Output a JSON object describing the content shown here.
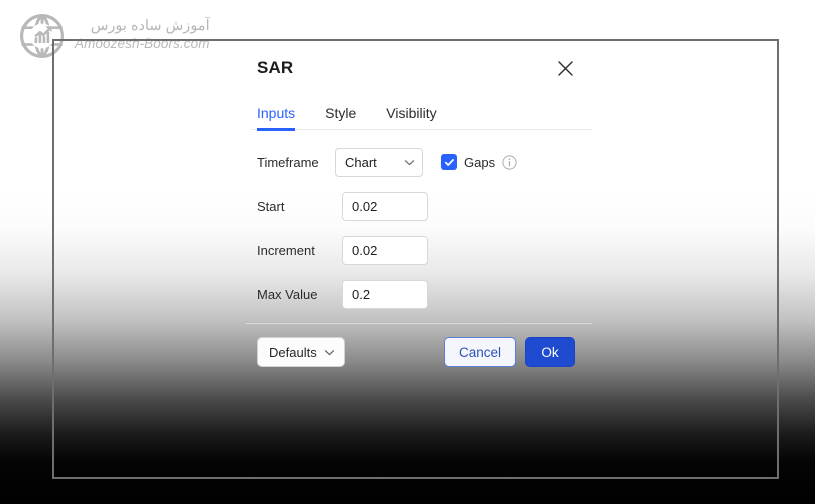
{
  "watermark": {
    "icon": "globe-chart-logo",
    "persian_text": "آموزش ساده بورس",
    "site": "Amoozesh-Boors.com"
  },
  "dialog": {
    "title": "SAR",
    "close_icon": "close-icon",
    "tabs": [
      {
        "label": "Inputs",
        "active": true
      },
      {
        "label": "Style",
        "active": false
      },
      {
        "label": "Visibility",
        "active": false
      }
    ],
    "fields": {
      "timeframe": {
        "label": "Timeframe",
        "value": "Chart",
        "chevron_icon": "chevron-down-icon"
      },
      "gaps": {
        "label": "Gaps",
        "checked": true,
        "check_icon": "check-icon",
        "info_icon": "info-icon"
      },
      "start": {
        "label": "Start",
        "value": "0.02"
      },
      "increment": {
        "label": "Increment",
        "value": "0.02"
      },
      "max_value": {
        "label": "Max Value",
        "value": "0.2"
      }
    },
    "footer": {
      "defaults_label": "Defaults",
      "defaults_chevron_icon": "chevron-down-icon",
      "cancel_label": "Cancel",
      "ok_label": "Ok"
    }
  },
  "colors": {
    "accent": "#2962ff",
    "ok_button": "#1f4bd0",
    "cancel_text": "#2f52b8",
    "frame_border": "#6e6e6e",
    "watermark_text": "#8b8b8b"
  }
}
